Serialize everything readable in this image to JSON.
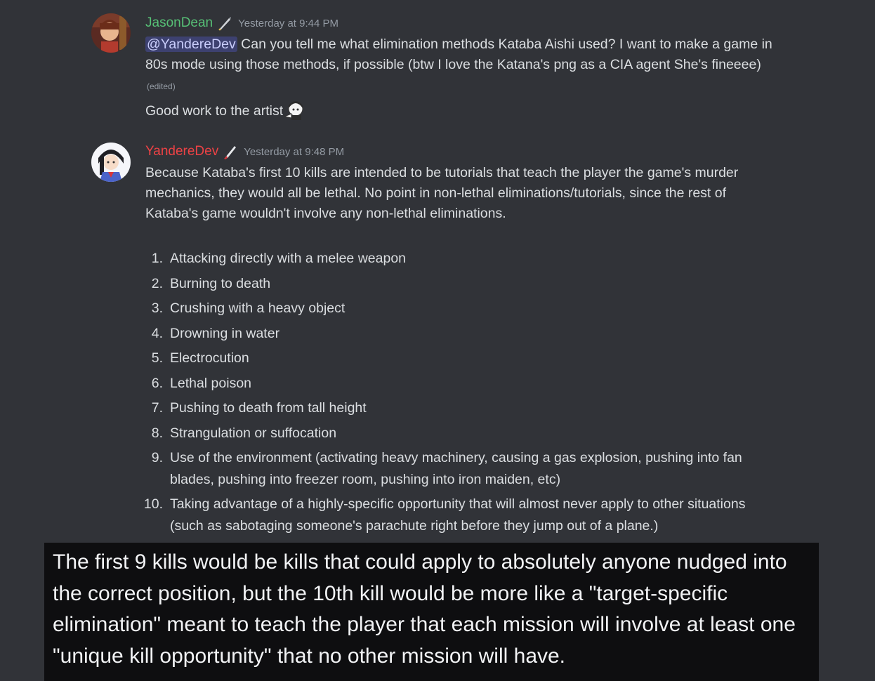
{
  "messages": [
    {
      "username": "JasonDean",
      "username_color": "#57c076",
      "timestamp": "Yesterday at 9:44 PM",
      "mention": "@YandereDev",
      "text_after_mention": " Can you tell me what elimination methods Kataba Aishi used? I want to make a game in  80s mode using those methods, if possible (btw I love the Katana's png as a CIA agent She's fineeee)",
      "edited_label": "(edited)",
      "second_line": "Good work to the artist"
    },
    {
      "username": "YandereDev",
      "username_color": "#ed4245",
      "timestamp": "Yesterday at 9:48 PM",
      "intro": "Because Kataba's first 10 kills are intended to be tutorials that teach the player the game's murder mechanics, they would all be lethal. No point in non-lethal eliminations/tutorials, since the rest of Kataba's game wouldn't involve any non-lethal eliminations.",
      "kills": [
        {
          "n": "1.",
          "text": "Attacking directly with a melee weapon"
        },
        {
          "n": "2.",
          "text": "Burning to death"
        },
        {
          "n": "3.",
          "text": "Crushing with a heavy object"
        },
        {
          "n": "4.",
          "text": "Drowning in water"
        },
        {
          "n": "5.",
          "text": "Electrocution"
        },
        {
          "n": "6.",
          "text": "Lethal poison"
        },
        {
          "n": "7.",
          "text": "Pushing to death from tall height"
        },
        {
          "n": "8.",
          "text": "Strangulation or suffocation"
        },
        {
          "n": "9.",
          "text": "Use of the environment (activating heavy machinery, causing a gas explosion, pushing into fan blades, pushing into freezer room, pushing into iron maiden, etc)"
        },
        {
          "n": "10.",
          "text": "Taking advantage of a highly-specific opportunity that will almost never apply to other situations (such as sabotaging someone's parachute right before they jump out of a plane.)"
        }
      ]
    }
  ],
  "caption": "The first 9 kills would be kills that could apply to absolutely anyone nudged into the correct position, but the 10th kill would be more like a \"target-specific elimination\" meant to teach the player that each mission will involve at least one \"unique kill opportunity\" that no other mission will have.",
  "icons": {
    "badge_1": "feather-pen-icon",
    "badge_2": "knife-icon",
    "emoji": "anime-girl-pointing-emoji"
  },
  "colors": {
    "background": "#313338",
    "mention_bg": "rgba(88,101,242,0.3)",
    "caption_bg": "#0e0e10"
  }
}
